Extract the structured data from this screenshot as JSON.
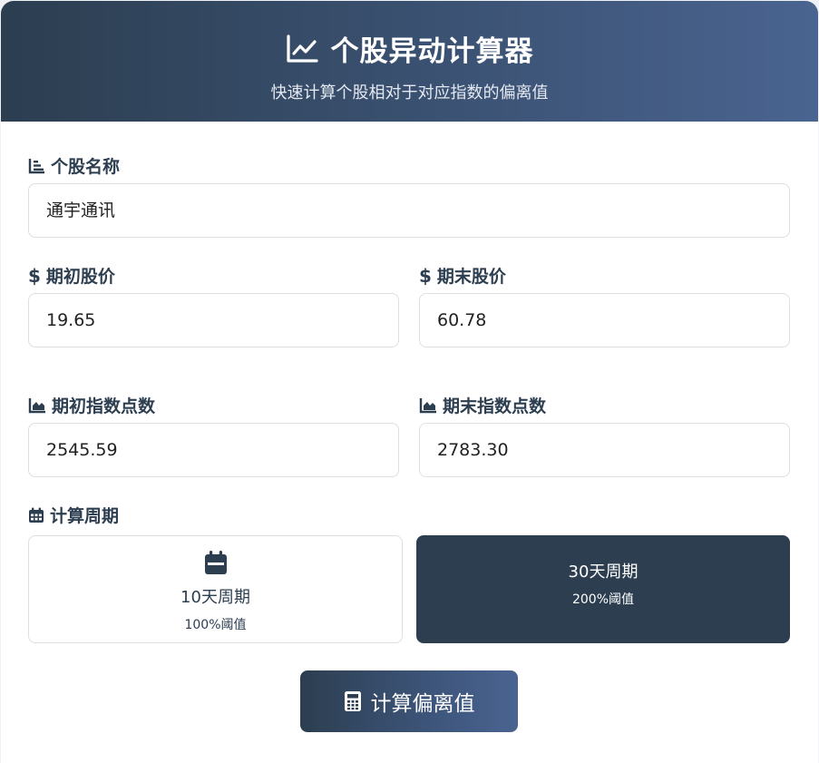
{
  "header": {
    "title": "个股异动计算器",
    "subtitle": "快速计算个股相对于对应指数的偏离值",
    "title_icon": "line-chart-icon"
  },
  "fields": {
    "stock_name": {
      "label": "个股名称",
      "value": "通宇通讯",
      "icon": "list-chart-icon"
    },
    "start_price": {
      "label": "期初股价",
      "value": "19.65",
      "icon": "dollar-icon"
    },
    "end_price": {
      "label": "期末股价",
      "value": "60.78",
      "icon": "dollar-icon"
    },
    "start_index": {
      "label": "期初指数点数",
      "value": "2545.59",
      "icon": "area-chart-icon"
    },
    "end_index": {
      "label": "期末指数点数",
      "value": "2783.30",
      "icon": "area-chart-icon"
    }
  },
  "period": {
    "label": "计算周期",
    "icon": "calendar-icon",
    "options": [
      {
        "name": "10天周期",
        "threshold": "100%阈值",
        "selected": false
      },
      {
        "name": "30天周期",
        "threshold": "200%阈值",
        "selected": true
      }
    ]
  },
  "calculate_button": {
    "label": "计算偏离值",
    "icon": "calculator-icon"
  },
  "colors": {
    "primary": "#2c3e50",
    "gradient_end": "#4a6491",
    "border": "#dcdfe4"
  }
}
